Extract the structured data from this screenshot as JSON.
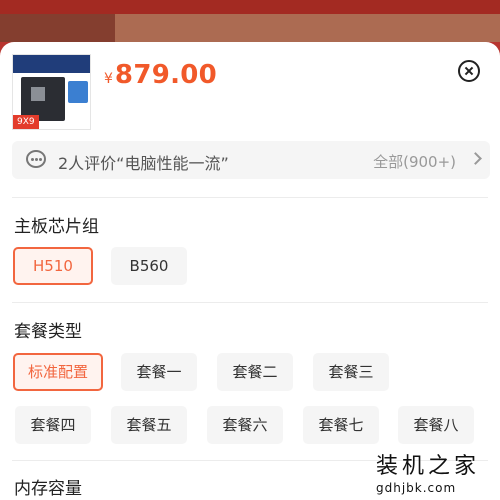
{
  "product": {
    "thumbnail_badge": "9X9",
    "price_symbol": "¥",
    "price": "879.00"
  },
  "review": {
    "summary": "2人评价“电脑性能一流”",
    "all_link": "全部(900+)"
  },
  "sections": {
    "chipset": {
      "title": "主板芯片组",
      "options": [
        "H510",
        "B560"
      ],
      "selected": "H510"
    },
    "package": {
      "title": "套餐类型",
      "options": [
        "标准配置",
        "套餐一",
        "套餐二",
        "套餐三",
        "套餐四",
        "套餐五",
        "套餐六",
        "套餐七",
        "套餐八"
      ],
      "selected": "标准配置"
    },
    "memory": {
      "title": "内存容量"
    }
  },
  "watermark": {
    "cn": "装机之家",
    "en": "gdhjbk.com"
  },
  "colors": {
    "accent": "#f1592a",
    "selected_border": "#f2663f",
    "backdrop": "#b8352f"
  }
}
